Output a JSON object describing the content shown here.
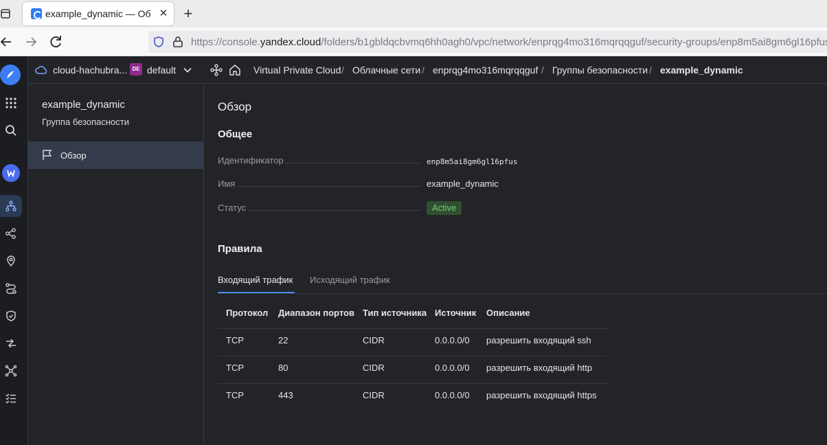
{
  "browser": {
    "tab_title": "example_dynamic — Об",
    "url_prefix": "https://console.",
    "url_host": "yandex.cloud",
    "url_path": "/folders/b1gbldqcbvmq6hh0agh0/vpc/network/enprqg4mo316mqrqqguf/security-groups/enp8m5ai8gm6gl16pfus"
  },
  "header": {
    "cloud": "cloud-hachubra...",
    "folder_badge": "DE",
    "folder": "default",
    "breadcrumbs": [
      "Virtual Private Cloud",
      "Облачные сети",
      "enprqg4mo316mqrqqguf",
      "Группы безопасности",
      "example_dynamic"
    ],
    "separator": "/"
  },
  "sidenav": {
    "resource_name": "example_dynamic",
    "resource_type": "Группа безопасности",
    "items": [
      {
        "label": "Обзор"
      }
    ]
  },
  "main": {
    "title": "Обзор",
    "general_heading": "Общее",
    "properties": {
      "id_label": "Идентификатор",
      "id_value": "enp8m5ai8gm6gl16pfus",
      "name_label": "Имя",
      "name_value": "example_dynamic",
      "status_label": "Статус",
      "status_value": "Active"
    },
    "rules_heading": "Правила",
    "tabs": [
      {
        "label": "Входящий трафик"
      },
      {
        "label": "Исходящий трафик"
      }
    ],
    "columns": [
      "Протокол",
      "Диапазон портов",
      "Тип источника",
      "Источник",
      "Описание"
    ],
    "rows": [
      [
        "TCP",
        "22",
        "CIDR",
        "0.0.0.0/0",
        "разрешить входящий ssh"
      ],
      [
        "TCP",
        "80",
        "CIDR",
        "0.0.0.0/0",
        "разрешить входящий http"
      ],
      [
        "TCP",
        "443",
        "CIDR",
        "0.0.0.0/0",
        "разрешить входящий https"
      ]
    ]
  },
  "colors": {
    "accent": "#4c8bf5",
    "status_active": "#74c979",
    "folder_badge": "#8e2a8e"
  }
}
